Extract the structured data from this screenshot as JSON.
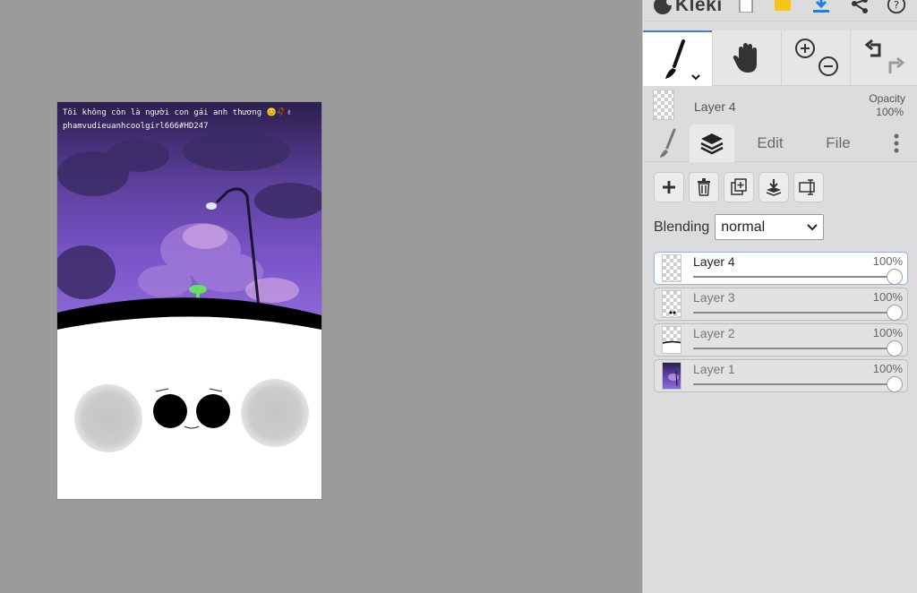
{
  "canvas": {
    "caption_line1": "Tôi không còn là người con gái anh thương 😊🥀✌",
    "caption_line2": "phamvudieuanhcoolgirl666#HD247"
  },
  "app": {
    "name": "Kleki",
    "accent_color": "#3b7fd4"
  },
  "topbar": {
    "icons": [
      "new-image-icon",
      "open-folder-icon",
      "download-icon",
      "share-icon",
      "help-icon"
    ]
  },
  "tools": [
    "brush-tool",
    "hand-tool",
    "zoom-in-out-tool",
    "undo-redo-tool"
  ],
  "current_layer": {
    "name": "Layer 4",
    "opacity_label": "Opacity",
    "opacity_value": "100%"
  },
  "tabs": {
    "brush": "brush",
    "layers": "layers",
    "edit": "Edit",
    "file": "File",
    "more": "more"
  },
  "layer_actions": [
    "add-layer",
    "delete-layer",
    "duplicate-layer",
    "merge-down",
    "rename-layer"
  ],
  "blending": {
    "label": "Blending",
    "value": "normal"
  },
  "layers": [
    {
      "name": "Layer 4",
      "opacity": "100%",
      "opacity_fraction": 1.0,
      "selected": true
    },
    {
      "name": "Layer 3",
      "opacity": "100%",
      "opacity_fraction": 1.0,
      "selected": false
    },
    {
      "name": "Layer 2",
      "opacity": "100%",
      "opacity_fraction": 1.0,
      "selected": false
    },
    {
      "name": "Layer 1",
      "opacity": "100%",
      "opacity_fraction": 1.0,
      "selected": false
    }
  ]
}
